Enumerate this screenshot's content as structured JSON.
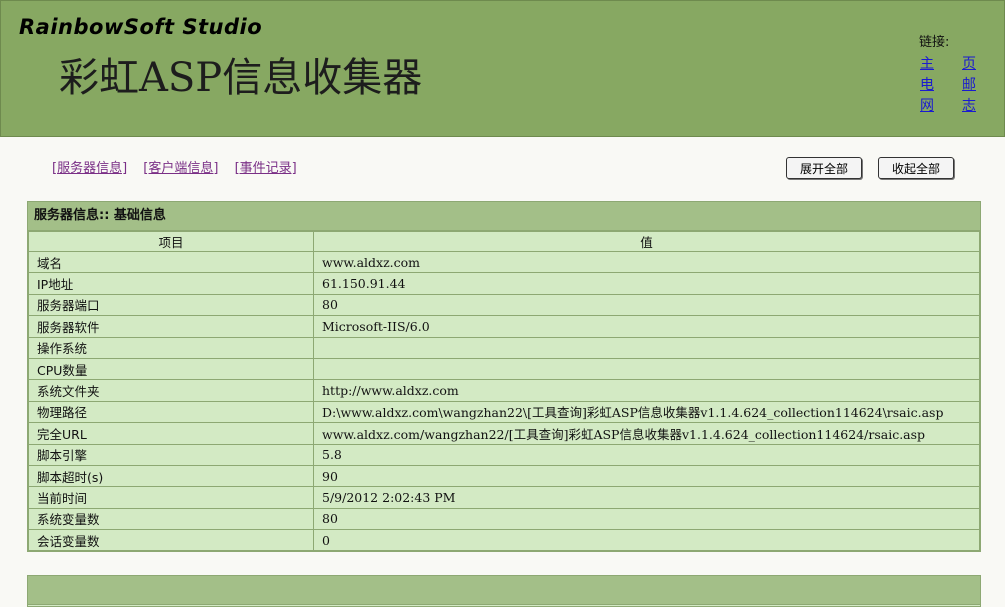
{
  "header": {
    "brand": "RainbowSoft Studio",
    "title": "彩虹ASP信息收集器",
    "links_label": "链接:",
    "links": [
      {
        "a": "主",
        "b": "页"
      },
      {
        "a": "电",
        "b": "邮"
      },
      {
        "a": "网",
        "b": "志"
      }
    ]
  },
  "nav": {
    "server": "[服务器信息]",
    "client": "[客户端信息]",
    "events": "[事件记录]"
  },
  "toolbar": {
    "expand_all": "展开全部",
    "collapse_all": "收起全部"
  },
  "panel": {
    "title": "服务器信息:: 基础信息",
    "col_item": "项目",
    "col_value": "值",
    "rows": [
      {
        "k": "域名",
        "v": "www.aldxz.com"
      },
      {
        "k": "IP地址",
        "v": "61.150.91.44"
      },
      {
        "k": "服务器端口",
        "v": "80"
      },
      {
        "k": "服务器软件",
        "v": "Microsoft-IIS/6.0"
      },
      {
        "k": "操作系统",
        "v": ""
      },
      {
        "k": "CPU数量",
        "v": ""
      },
      {
        "k": "系统文件夹",
        "v": "http://www.aldxz.com"
      },
      {
        "k": "物理路径",
        "v": "D:\\www.aldxz.com\\wangzhan22\\[工具查询]彩虹ASP信息收集器v1.1.4.624_collection114624\\rsaic.asp"
      },
      {
        "k": "完全URL",
        "v": "www.aldxz.com/wangzhan22/[工具查询]彩虹ASP信息收集器v1.1.4.624_collection114624/rsaic.asp"
      },
      {
        "k": "脚本引擎",
        "v": "5.8"
      },
      {
        "k": "脚本超时(s)",
        "v": "90"
      },
      {
        "k": "当前时间",
        "v": "5/9/2012 2:02:43 PM"
      },
      {
        "k": "系统变量数",
        "v": "80"
      },
      {
        "k": "会话变量数",
        "v": "0"
      }
    ]
  },
  "colors": {
    "header_bg": "#87a862",
    "panel_bg": "#d3eac4",
    "panel_header_bg": "#a3bf88",
    "link": "#1a1ad0",
    "nav_link": "#7a2f86"
  }
}
